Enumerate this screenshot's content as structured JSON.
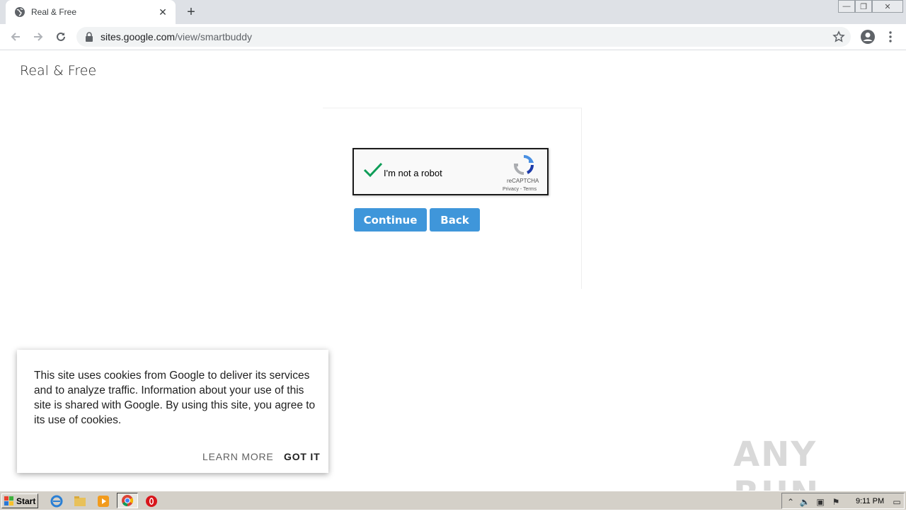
{
  "browser": {
    "tab_title": "Real & Free",
    "url_host": "sites.google.com",
    "url_path": "/view/smartbuddy"
  },
  "page": {
    "site_title": "Real & Free",
    "recaptcha": {
      "label": "I'm not a robot",
      "brand": "reCAPTCHA",
      "terms": "Privacy - Terms"
    },
    "continue_label": "Continue",
    "back_label": "Back"
  },
  "cookie_banner": {
    "message": "This site uses cookies from Google to deliver its services and to analyze traffic. Information about your use of this site is shared with Google. By using this site, you agree to its use of cookies.",
    "learn_more": "LEARN MORE",
    "got_it": "GOT IT"
  },
  "watermark": "ANY RUN",
  "taskbar": {
    "start_label": "Start",
    "clock": "9:11 PM"
  },
  "colors": {
    "button_blue": "#3f96da",
    "check_green": "#0f9d58"
  }
}
